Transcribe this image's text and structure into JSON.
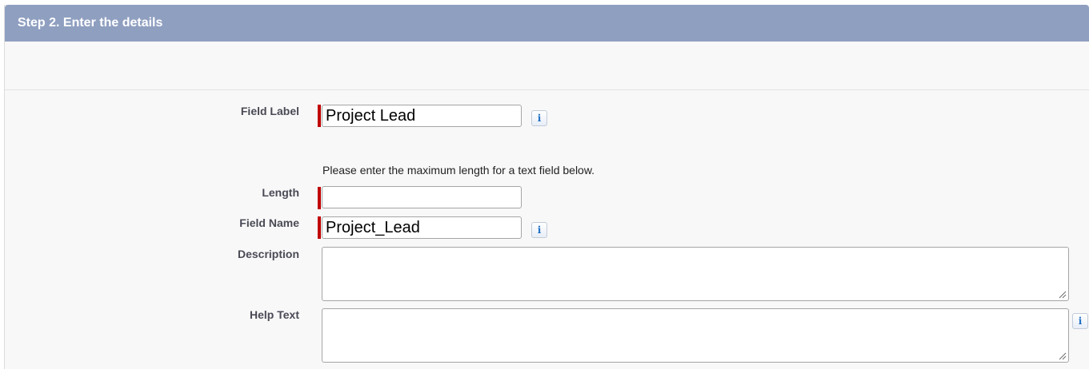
{
  "step": {
    "title": "Step 2. Enter the details"
  },
  "fields": {
    "field_label": {
      "label": "Field Label",
      "value": "Project Lead"
    },
    "length_note": "Please enter the maximum length for a text field below.",
    "length": {
      "label": "Length",
      "value": ""
    },
    "field_name": {
      "label": "Field Name",
      "value": "Project_Lead"
    },
    "description": {
      "label": "Description",
      "value": ""
    },
    "help_text": {
      "label": "Help Text",
      "value": ""
    }
  },
  "icons": {
    "info_glyph": "i",
    "info_icon_name": "info-icon",
    "resize_icon_name": "resize-grip-icon"
  },
  "colors": {
    "header_bg": "#8f9fc0",
    "required_marker": "#c00000",
    "panel_bg": "#f8f8f8",
    "info_icon": "#1f6fc5"
  }
}
